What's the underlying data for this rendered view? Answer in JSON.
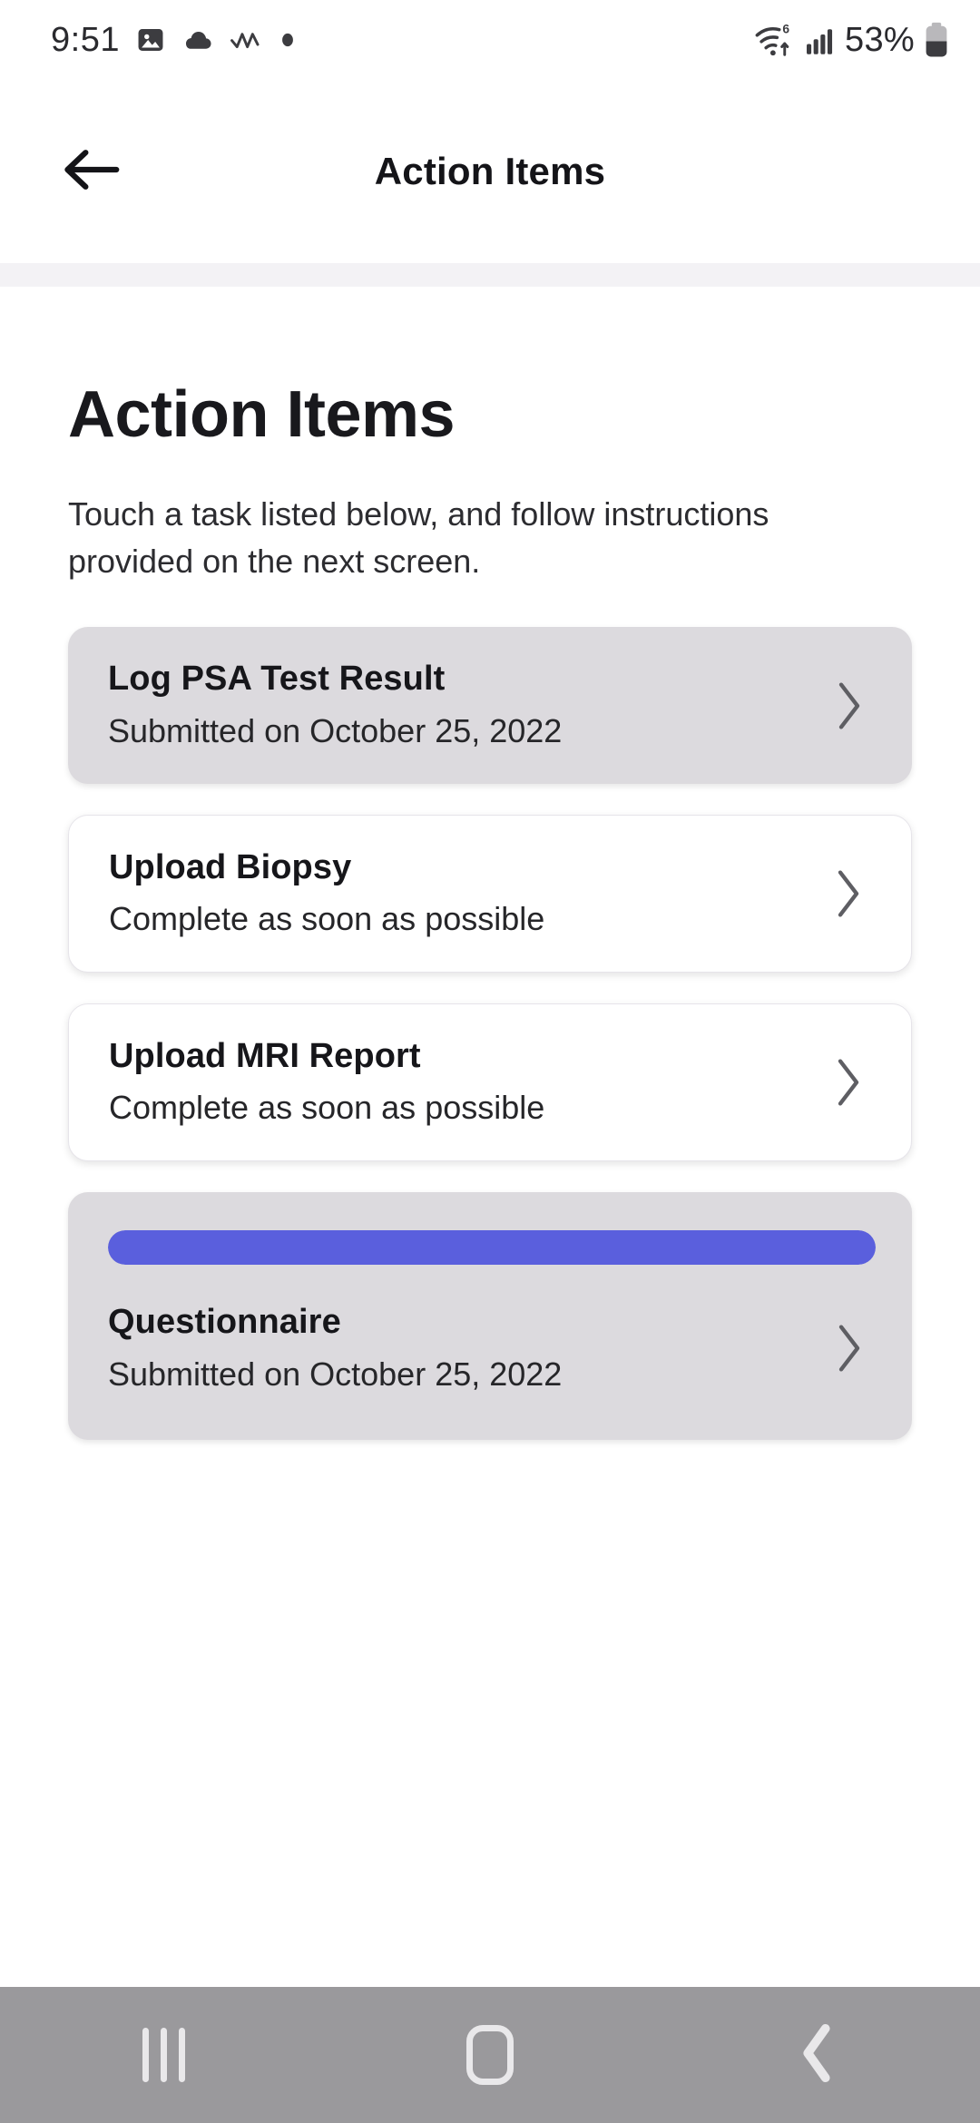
{
  "status_bar": {
    "time": "9:51",
    "left_icons": [
      "photo-icon",
      "cloud-icon",
      "wave-icon",
      "dot-icon"
    ],
    "wifi_label": "6",
    "right_icons": [
      "wifi-6-icon",
      "cellular-signal-icon"
    ],
    "battery_percent": "53%"
  },
  "app_bar": {
    "back_icon": "arrow-left-icon",
    "title": "Action Items"
  },
  "main": {
    "title": "Action Items",
    "subtitle": "Touch a task listed below, and follow instructions provided on the next screen.",
    "cards": [
      {
        "title": "Log PSA Test Result",
        "subtitle": "Submitted on October 25, 2022",
        "state": "done",
        "chevron": "chevron-right-icon",
        "has_progress": false
      },
      {
        "title": "Upload Biopsy",
        "subtitle": "Complete as soon as possible",
        "state": "pending",
        "chevron": "chevron-right-icon",
        "has_progress": false
      },
      {
        "title": "Upload MRI Report",
        "subtitle": "Complete as soon as possible",
        "state": "pending",
        "chevron": "chevron-right-icon",
        "has_progress": false
      },
      {
        "title": "Questionnaire",
        "subtitle": "Submitted on October 25, 2022",
        "state": "done",
        "chevron": "chevron-right-icon",
        "has_progress": true,
        "progress_percent": 100
      }
    ]
  },
  "nav_bar": {
    "recents_label": "recents-icon",
    "home_label": "home-icon",
    "back_label": "back-icon"
  },
  "colors": {
    "accent_purple": "#5a5fdd",
    "card_done_bg": "#dcdade",
    "card_pending_bg": "#ffffff",
    "divider_strip": "#f3f2f5",
    "nav_bar_bg": "#9a999c",
    "text_primary": "#16161a"
  }
}
